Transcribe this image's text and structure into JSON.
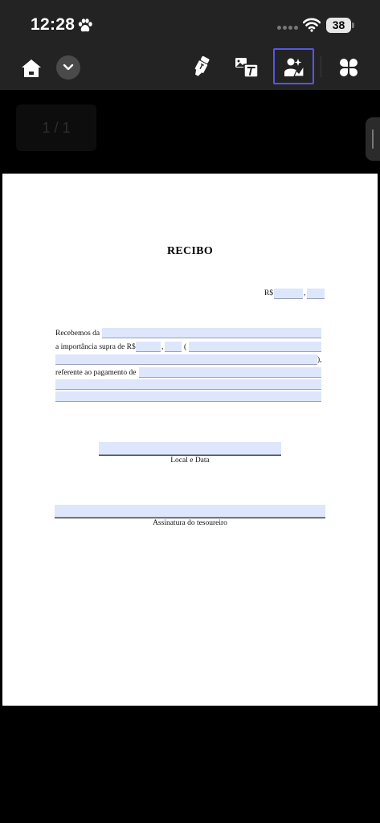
{
  "status_bar": {
    "time": "12:28",
    "battery": "38",
    "icons": [
      "paw-icon",
      "signal-icon",
      "wifi-icon",
      "battery-icon"
    ]
  },
  "toolbar": {
    "buttons": [
      "home-icon",
      "chevron-down-icon",
      "marker-icon",
      "ocr-text-icon",
      "ai-image-icon",
      "grid-icon"
    ],
    "active_button": "ai-image-icon",
    "accent_color": "#5558e8"
  },
  "viewer": {
    "page_indicator": "1 / 1"
  },
  "document": {
    "title": "RECIBO",
    "amount_prefix": "R$",
    "amount_comma": ",",
    "received_from_label": "Recebemos da",
    "amount_label": "a importância supra de R$",
    "amount_comma_2": ",",
    "paren_open": "(",
    "paren_close": "),",
    "reference_label": "referente ao pagamento de",
    "place_date_label": "Local e Data",
    "signature_label": "Assinatura do tesoureiro",
    "field_color": "#dde6fb"
  }
}
